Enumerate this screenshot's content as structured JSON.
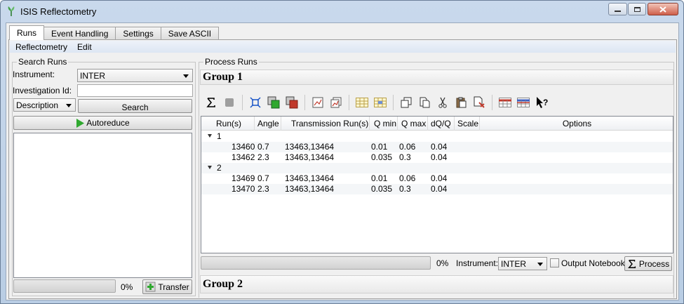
{
  "window": {
    "title": "ISIS Reflectometry"
  },
  "tabs": [
    {
      "label": "Runs"
    },
    {
      "label": "Event Handling"
    },
    {
      "label": "Settings"
    },
    {
      "label": "Save ASCII"
    }
  ],
  "menu": [
    {
      "label": "Reflectometry"
    },
    {
      "label": "Edit"
    }
  ],
  "search_runs": {
    "title": "Search Runs",
    "instrument_label": "Instrument:",
    "instrument_value": "INTER",
    "investigation_label": "Investigation Id:",
    "investigation_value": "",
    "description_value": "Description",
    "search_label": "Search",
    "autoreduce_label": "Autoreduce",
    "progress_text": "0%",
    "progress_value": 0,
    "transfer_label": "Transfer"
  },
  "process_runs": {
    "title": "Process Runs",
    "group1_title": "Group 1",
    "group2_title": "Group 2",
    "columns": [
      "Run(s)",
      "Angle",
      "Transmission Run(s)",
      "Q min",
      "Q max",
      "dQ/Q",
      "Scale",
      "Options"
    ],
    "groups": [
      {
        "name": "1",
        "rows": [
          {
            "run": "13460",
            "angle": "0.7",
            "trans": "13463,13464",
            "qmin": "0.01",
            "qmax": "0.06",
            "dqq": "0.04",
            "scale": "",
            "options": ""
          },
          {
            "run": "13462",
            "angle": "2.3",
            "trans": "13463,13464",
            "qmin": "0.035",
            "qmax": "0.3",
            "dqq": "0.04",
            "scale": "",
            "options": ""
          }
        ]
      },
      {
        "name": "2",
        "rows": [
          {
            "run": "13469",
            "angle": "0.7",
            "trans": "13463,13464",
            "qmin": "0.01",
            "qmax": "0.06",
            "dqq": "0.04",
            "scale": "",
            "options": ""
          },
          {
            "run": "13470",
            "angle": "2.3",
            "trans": "13463,13464",
            "qmin": "0.035",
            "qmax": "0.3",
            "dqq": "0.04",
            "scale": "",
            "options": ""
          }
        ]
      }
    ],
    "progress_text": "0%",
    "progress_value": 0,
    "instrument_label": "Instrument:",
    "instrument_value": "INTER",
    "output_notebook_label": "Output Notebook",
    "output_notebook_checked": false,
    "process_label": "Process"
  },
  "toolbar_icons": [
    "process-sigma-icon",
    "pause-icon",
    "sep",
    "expand-all-icon",
    "insert-row-icon",
    "delete-row-icon",
    "sep",
    "plot-row-icon",
    "plot-group-icon",
    "sep",
    "group-rows-icon",
    "ungroup-rows-icon",
    "sep",
    "copy-icon",
    "copy-selected-icon",
    "cut-icon",
    "paste-icon",
    "clear-icon",
    "sep",
    "import-table-icon",
    "export-table-icon",
    "whats-this-icon"
  ],
  "colors": {
    "accent_green": "#2fa82f",
    "title_bar": "#c3d5ea",
    "menu_bar": "#e3eaf5"
  }
}
